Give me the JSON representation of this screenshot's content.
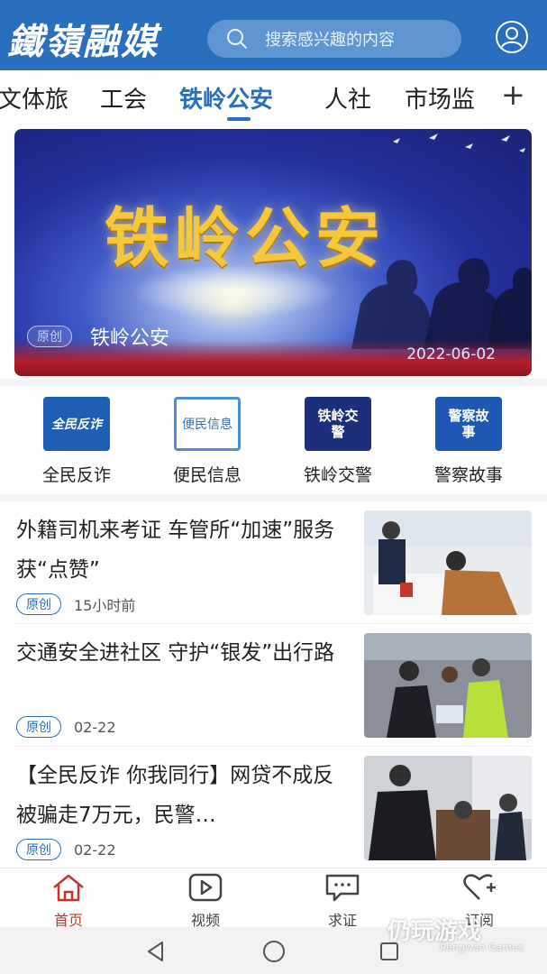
{
  "header": {
    "logo_text": "鐵嶺融媒",
    "search_placeholder": "搜索感兴趣的内容",
    "colors": {
      "brand": "#2a6fbd",
      "search_bg": "#5f95d0"
    }
  },
  "tabs": {
    "items": [
      "文体旅",
      "工会",
      "铁岭公安",
      "人社",
      "市场监"
    ],
    "active": "铁岭公安",
    "more_label": "+"
  },
  "banner": {
    "headline": "铁岭公安",
    "badge": "原创",
    "caption": "铁岭公安",
    "date": "2022-06-02"
  },
  "quick_links": [
    {
      "label": "全民反诈",
      "icon_text": "全民反诈",
      "icon": "anti-fraud-shield-icon",
      "color": "#1e5fb5"
    },
    {
      "label": "便民信息",
      "icon_text": "便民信息",
      "icon": "convenience-info-icon",
      "color": "#4a8fd8"
    },
    {
      "label": "铁岭交警",
      "icon_text": "铁岭交警",
      "icon": "traffic-police-icon",
      "color": "#1c2f7a"
    },
    {
      "label": "警察故事",
      "icon_text": "警察故事",
      "icon": "police-story-icon",
      "color": "#1e58b5"
    }
  ],
  "news": [
    {
      "title": "外籍司机来考证 车管所“加速”服务获“点赞”",
      "badge": "原创",
      "time": "15小时前"
    },
    {
      "title": "交通安全进社区 守护“银发”出行路",
      "badge": "原创",
      "time": "02-22"
    },
    {
      "title": "【全民反诈 你我同行】网贷不成反被骗走7万元，民警…",
      "badge": "原创",
      "time": "02-22"
    }
  ],
  "bottom_nav": [
    {
      "label": "首页",
      "icon": "home-icon",
      "active": true
    },
    {
      "label": "视频",
      "icon": "video-play-icon",
      "active": false
    },
    {
      "label": "求证",
      "icon": "chat-verify-icon",
      "active": false
    },
    {
      "label": "订阅",
      "icon": "heart-plus-icon",
      "active": false
    }
  ],
  "watermark": {
    "text": "仍玩游戏",
    "sub": "Rengwan Games"
  }
}
